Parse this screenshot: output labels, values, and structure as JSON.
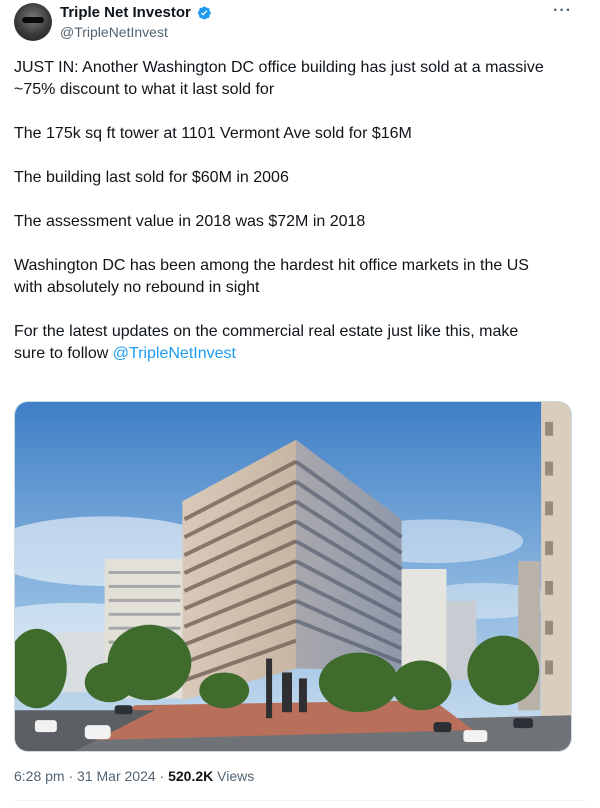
{
  "author": {
    "display_name": "Triple Net Investor",
    "handle": "@TripleNetInvest",
    "verified": true,
    "avatar_icon": "profile-photo"
  },
  "more_icon": "ellipsis-icon",
  "tweet": {
    "para1": "JUST IN: Another Washington DC office building has just sold at a massive ~75% discount to what it last sold for",
    "para2": "The 175k sq ft tower at 1101 Vermont Ave sold for $16M",
    "para3": "The building last sold for $60M in 2006",
    "para4": "The assessment value in 2018 was $72M in 2018",
    "para5": "Washington DC has been among the hardest hit office markets in the US\nwith absolutely no rebound in sight",
    "para6_prefix": "For the latest updates on the commercial real estate just like this, make\nsure to follow ",
    "para6_mention": "@TripleNetInvest"
  },
  "media": {
    "type": "photo"
  },
  "meta": {
    "time": "6:28 pm",
    "separator": " · ",
    "date": "31 Mar 2024",
    "views_count": "520.2K",
    "views_label": " Views"
  },
  "colors": {
    "link": "#1d9bf0",
    "secondary_text": "#536471",
    "verified": "#1d9bf0"
  }
}
